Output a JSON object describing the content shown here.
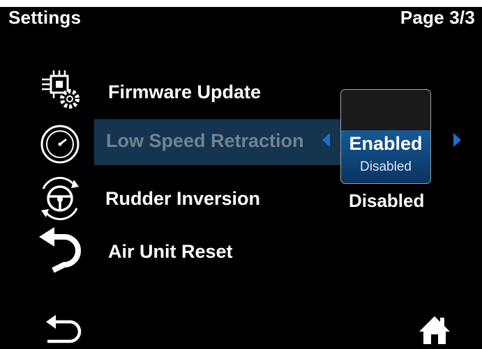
{
  "header": {
    "title": "Settings",
    "page_indicator": "Page 3/3"
  },
  "menu": {
    "items": [
      {
        "label": "Firmware Update",
        "icon": "firmware-chip-gear-icon"
      },
      {
        "label": "Low Speed Retraction",
        "icon": "speedometer-icon",
        "selected": true
      },
      {
        "label": "Rudder Inversion",
        "icon": "steering-wheel-rotate-icon",
        "value": "Disabled"
      },
      {
        "label": "Air Unit Reset",
        "icon": "reset-arrow-icon"
      }
    ]
  },
  "popup": {
    "selected_option": "Enabled",
    "other_option": "Disabled"
  },
  "footer": {
    "back_icon": "back-arrow-icon",
    "home_icon": "home-icon"
  },
  "colors": {
    "highlight": "#143450",
    "accent": "#1b6fd0",
    "popup_blue": "#165a98"
  }
}
